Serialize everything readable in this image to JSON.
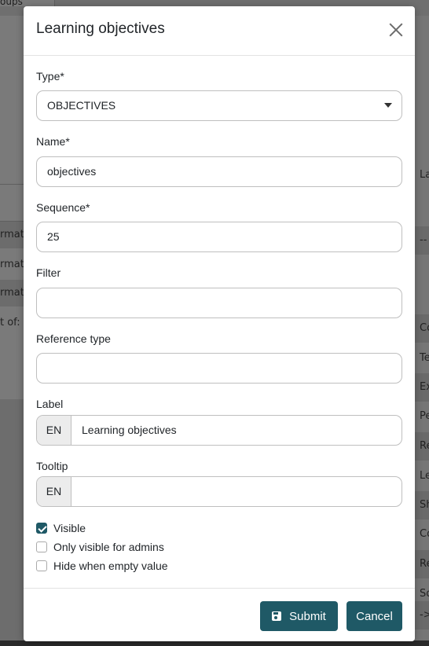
{
  "background": {
    "tab_label": "oups",
    "left_rows": [
      "rmati",
      "rmati",
      "rmati",
      "t of:"
    ],
    "right_header": "La",
    "right_rows": [
      "--",
      "Co",
      "Te",
      "Ex",
      "Pe",
      "Re",
      "Le",
      "Sh",
      "Co",
      "Re",
      "So",
      "->"
    ]
  },
  "modal": {
    "title": "Learning objectives",
    "type": {
      "label": "Type*",
      "value": "OBJECTIVES"
    },
    "name": {
      "label": "Name*",
      "value": "objectives"
    },
    "sequence": {
      "label": "Sequence*",
      "value": "25"
    },
    "filter": {
      "label": "Filter",
      "value": ""
    },
    "reference_type": {
      "label": "Reference type",
      "value": ""
    },
    "label_field": {
      "label": "Label",
      "lang": "EN",
      "value": "Learning objectives"
    },
    "tooltip": {
      "label": "Tooltip",
      "lang": "EN",
      "value": ""
    },
    "checkboxes": [
      {
        "label": "Visible",
        "checked": true
      },
      {
        "label": "Only visible for admins",
        "checked": false
      },
      {
        "label": "Hide when empty value",
        "checked": false
      }
    ],
    "submit_label": "Submit",
    "cancel_label": "Cancel"
  },
  "colors": {
    "primary": "#1f5966",
    "overlay": "#7b7b7b"
  }
}
